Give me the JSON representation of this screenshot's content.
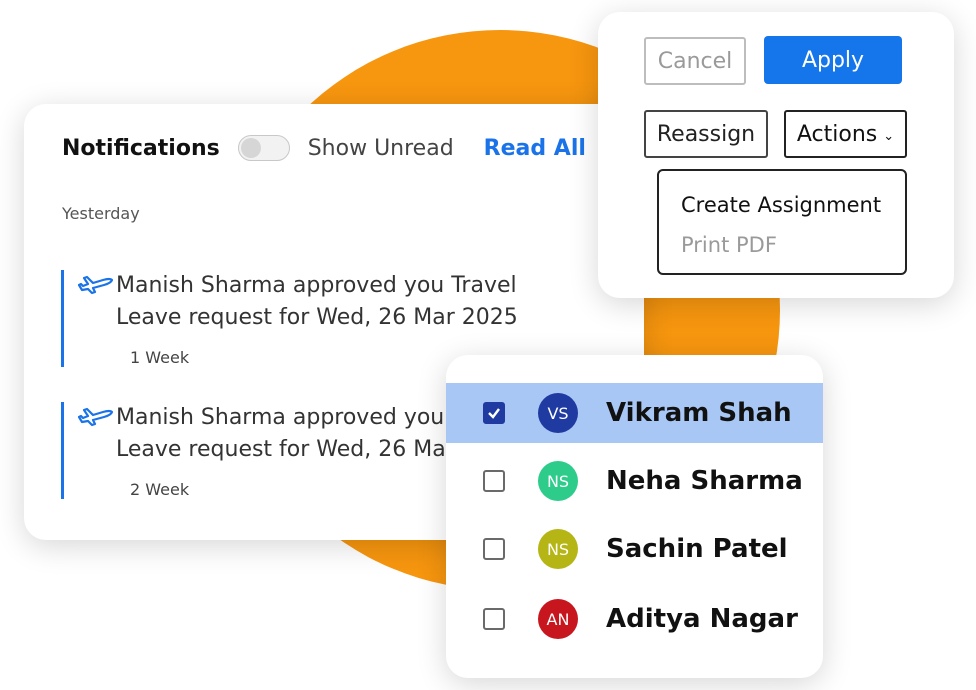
{
  "colors": {
    "accent": "#1a73e8",
    "blob": "#f7960f",
    "selected_row": "#a8c7f5"
  },
  "notifications": {
    "title": "Notifications",
    "toggle_label": "Show Unread",
    "toggle_on": false,
    "read_all": "Read All",
    "section": "Yesterday",
    "items": [
      {
        "icon": "airplane-icon",
        "message": "Manish Sharma approved you Travel Leave request for Wed, 26 Mar 2025",
        "time": "1 Week"
      },
      {
        "icon": "airplane-icon",
        "message": "Manish Sharma approved you Travel Leave request for Wed, 26 Mar 2025",
        "time": "2 Week"
      }
    ]
  },
  "actions": {
    "cancel": "Cancel",
    "apply": "Apply",
    "reassign": "Reassign",
    "actions": "Actions",
    "menu": [
      "Create Assignment",
      "Print PDF"
    ]
  },
  "users": [
    {
      "initials": "VS",
      "name": "Vikram Shah",
      "checked": true,
      "color": "#1f3aa0"
    },
    {
      "initials": "NS",
      "name": "Neha Sharma",
      "checked": false,
      "color": "#2ecc8a"
    },
    {
      "initials": "NS",
      "name": "Sachin Patel",
      "checked": false,
      "color": "#b5b515"
    },
    {
      "initials": "AN",
      "name": "Aditya Nagar",
      "checked": false,
      "color": "#c8161e"
    }
  ]
}
